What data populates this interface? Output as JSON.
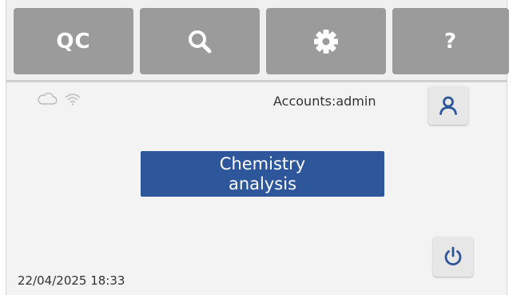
{
  "toolbar": {
    "qc_label": "QC",
    "search_icon": "search-icon",
    "settings_icon": "gear-icon",
    "help_label": "?"
  },
  "status": {
    "cloud_icon": "cloud-icon",
    "wifi_icon": "wifi-icon",
    "accounts_label": "Accounts:admin"
  },
  "main": {
    "analysis_button_label": "Chemistry analysis"
  },
  "footer": {
    "datetime": "22/04/2025 18:33"
  },
  "colors": {
    "toolbar_button": "#9b9b9b",
    "accent_blue": "#2e569b",
    "background": "#f3f3f3"
  }
}
